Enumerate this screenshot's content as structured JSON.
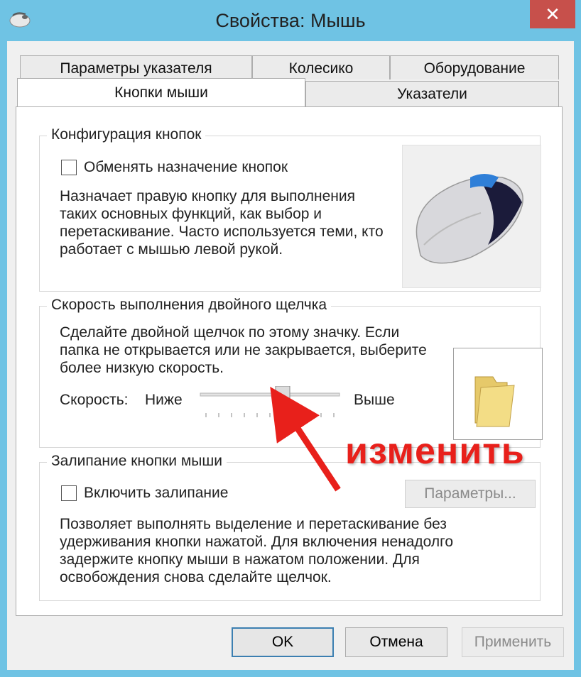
{
  "window": {
    "title": "Свойства: Мышь",
    "close_glyph": "✕"
  },
  "tabs": {
    "row1": [
      "Параметры указателя",
      "Колесико",
      "Оборудование"
    ],
    "row2": [
      "Кнопки мыши",
      "Указатели"
    ],
    "active": "Кнопки мыши"
  },
  "button_config": {
    "title": "Конфигурация кнопок",
    "checkbox_label": "Обменять назначение кнопок",
    "checked": false,
    "description": "Назначает правую кнопку для выполнения таких основных функций, как выбор и перетаскивание. Часто используется теми, кто работает с мышью левой рукой."
  },
  "double_click": {
    "title": "Скорость выполнения двойного щелчка",
    "description": "Сделайте двойной щелчок по этому значку. Если папка не открывается или не закрывается, выберите более низкую скорость.",
    "speed_label": "Скорость:",
    "low_label": "Ниже",
    "high_label": "Выше",
    "slider_value": 0.6,
    "tick_count": 11
  },
  "click_lock": {
    "title": "Залипание кнопки мыши",
    "checkbox_label": "Включить залипание",
    "checked": false,
    "settings_button": "Параметры...",
    "description": "Позволяет выполнять выделение и перетаскивание без удерживания кнопки нажатой. Для включения ненадолго задержите кнопку мыши в нажатом положении. Для освобождения снова сделайте щелчок."
  },
  "footer": {
    "ok": "OK",
    "cancel": "Отмена",
    "apply": "Применить"
  },
  "annotation": {
    "text": "изменить",
    "color": "#e8201b"
  }
}
